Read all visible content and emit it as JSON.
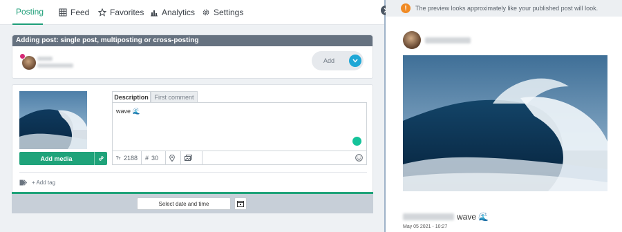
{
  "nav": {
    "tabs": [
      {
        "label": "Posting",
        "icon": "calendar-icon",
        "active": true
      },
      {
        "label": "Feed",
        "icon": "grid-icon",
        "active": false
      },
      {
        "label": "Favorites",
        "icon": "star-icon",
        "active": false
      },
      {
        "label": "Analytics",
        "icon": "bar-chart-icon",
        "active": false
      },
      {
        "label": "Settings",
        "icon": "gear-icon",
        "active": false
      }
    ]
  },
  "post": {
    "header": "Adding post: single post, multiposting or cross-posting",
    "add_label": "Add"
  },
  "editor": {
    "tabs": [
      "Description",
      "First comment"
    ],
    "text": "wave 🌊",
    "add_media_label": "Add media",
    "char_count": "2188",
    "hashtag_count": "30",
    "add_tag_label": "+ Add tag"
  },
  "schedule": {
    "date_button_label": "Select date and time"
  },
  "preview": {
    "notice": "The preview looks approximately like your published post will look.",
    "caption_text": "wave 🌊",
    "date": "May 05 2021 - 10:27"
  },
  "colors": {
    "accent": "#1d9e78",
    "header_bar": "#667280",
    "warning": "#f08a24"
  }
}
